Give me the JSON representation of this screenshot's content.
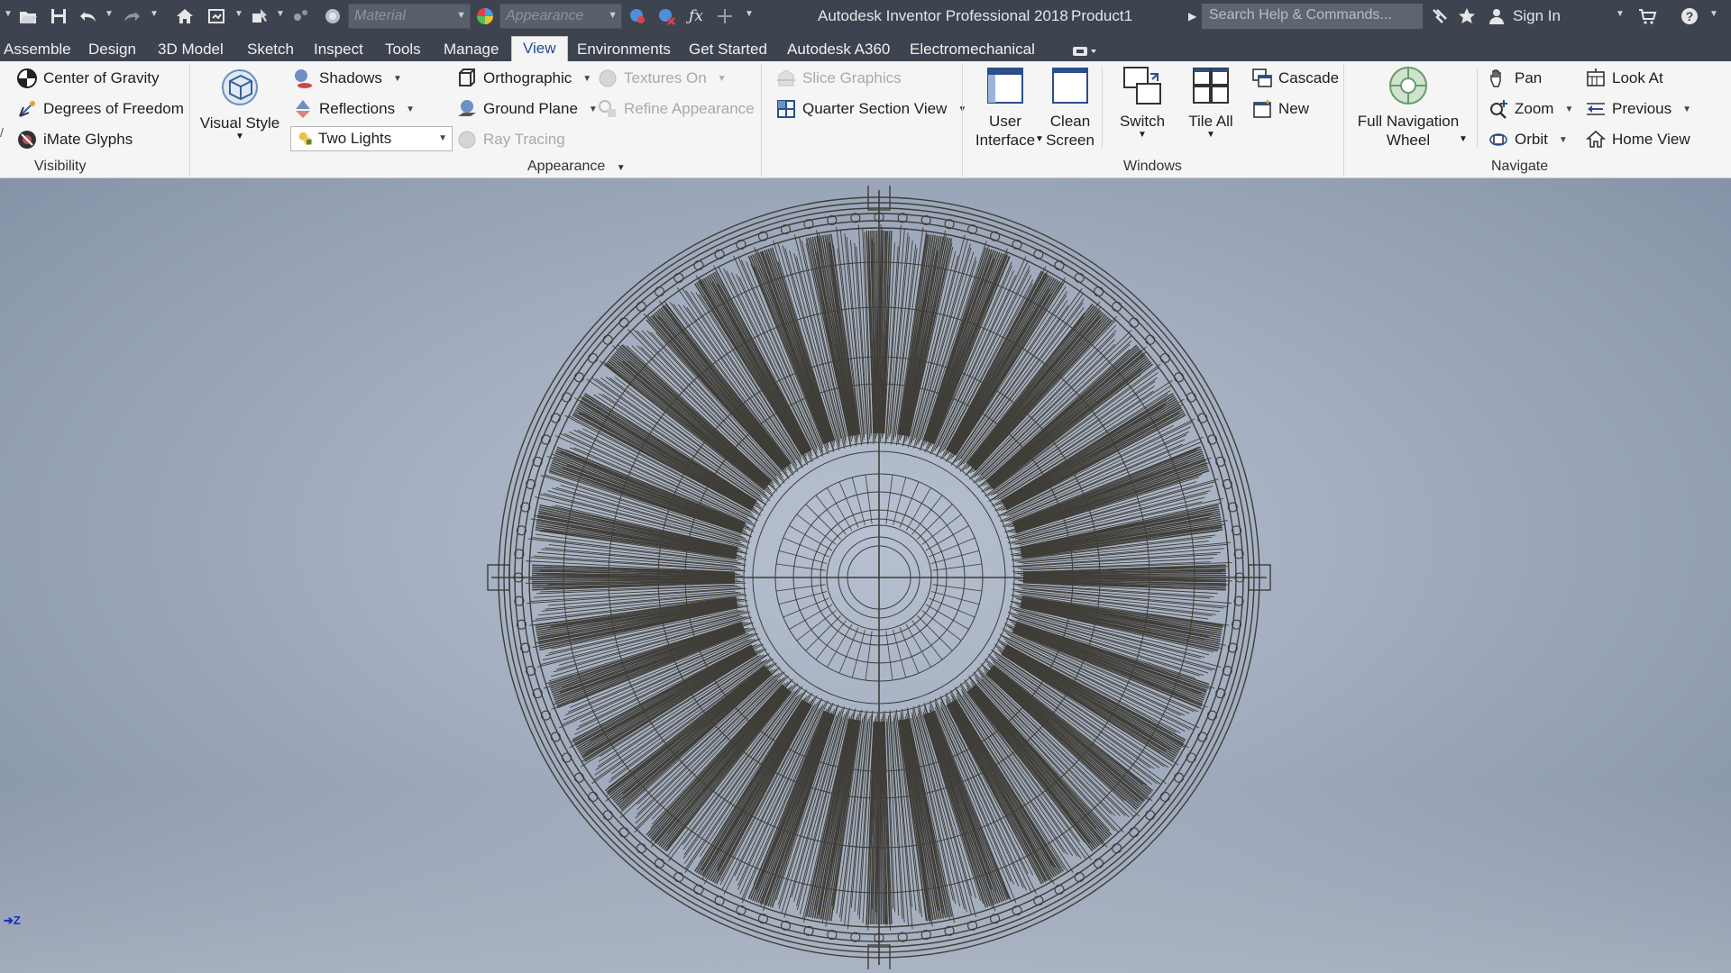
{
  "titlebar": {
    "app_title": "Autodesk Inventor Professional 2018",
    "document": "Product1",
    "material_placeholder": "Material",
    "appearance_placeholder": "Appearance",
    "search_placeholder": "Search Help & Commands...",
    "sign_in": "Sign In"
  },
  "tabs": [
    {
      "label": "Assemble"
    },
    {
      "label": "Design"
    },
    {
      "label": "3D Model"
    },
    {
      "label": "Sketch"
    },
    {
      "label": "Inspect"
    },
    {
      "label": "Tools"
    },
    {
      "label": "Manage"
    },
    {
      "label": "View",
      "active": true
    },
    {
      "label": "Environments"
    },
    {
      "label": "Get Started"
    },
    {
      "label": "Autodesk A360"
    },
    {
      "label": "Electromechanical"
    }
  ],
  "ribbon": {
    "visibility": {
      "label": "Visibility",
      "items": [
        "Center of Gravity",
        "Degrees of Freedom",
        "iMate Glyphs"
      ]
    },
    "appearance": {
      "label": "Appearance",
      "visual_style": "Visual Style",
      "shadows": "Shadows",
      "reflections": "Reflections",
      "lighting": "Two Lights",
      "orthographic": "Orthographic",
      "ground_plane": "Ground Plane",
      "ray_tracing": "Ray Tracing",
      "textures_on": "Textures On",
      "refine_appearance": "Refine Appearance",
      "slice_graphics": "Slice Graphics",
      "quarter_section": "Quarter Section View"
    },
    "windows": {
      "label": "Windows",
      "user_interface_1": "User",
      "user_interface_2": "Interface",
      "clean_screen_1": "Clean",
      "clean_screen_2": "Screen",
      "switch": "Switch",
      "tile_all": "Tile All",
      "cascade": "Cascade",
      "new": "New"
    },
    "navigate": {
      "label": "Navigate",
      "full_nav_1": "Full Navigation",
      "full_nav_2": "Wheel",
      "pan": "Pan",
      "zoom": "Zoom",
      "orbit": "Orbit",
      "look_at": "Look At",
      "previous": "Previous",
      "home_view": "Home View"
    }
  },
  "viewport": {
    "triad_axis": "Z",
    "model_color": "#3f3d37"
  }
}
